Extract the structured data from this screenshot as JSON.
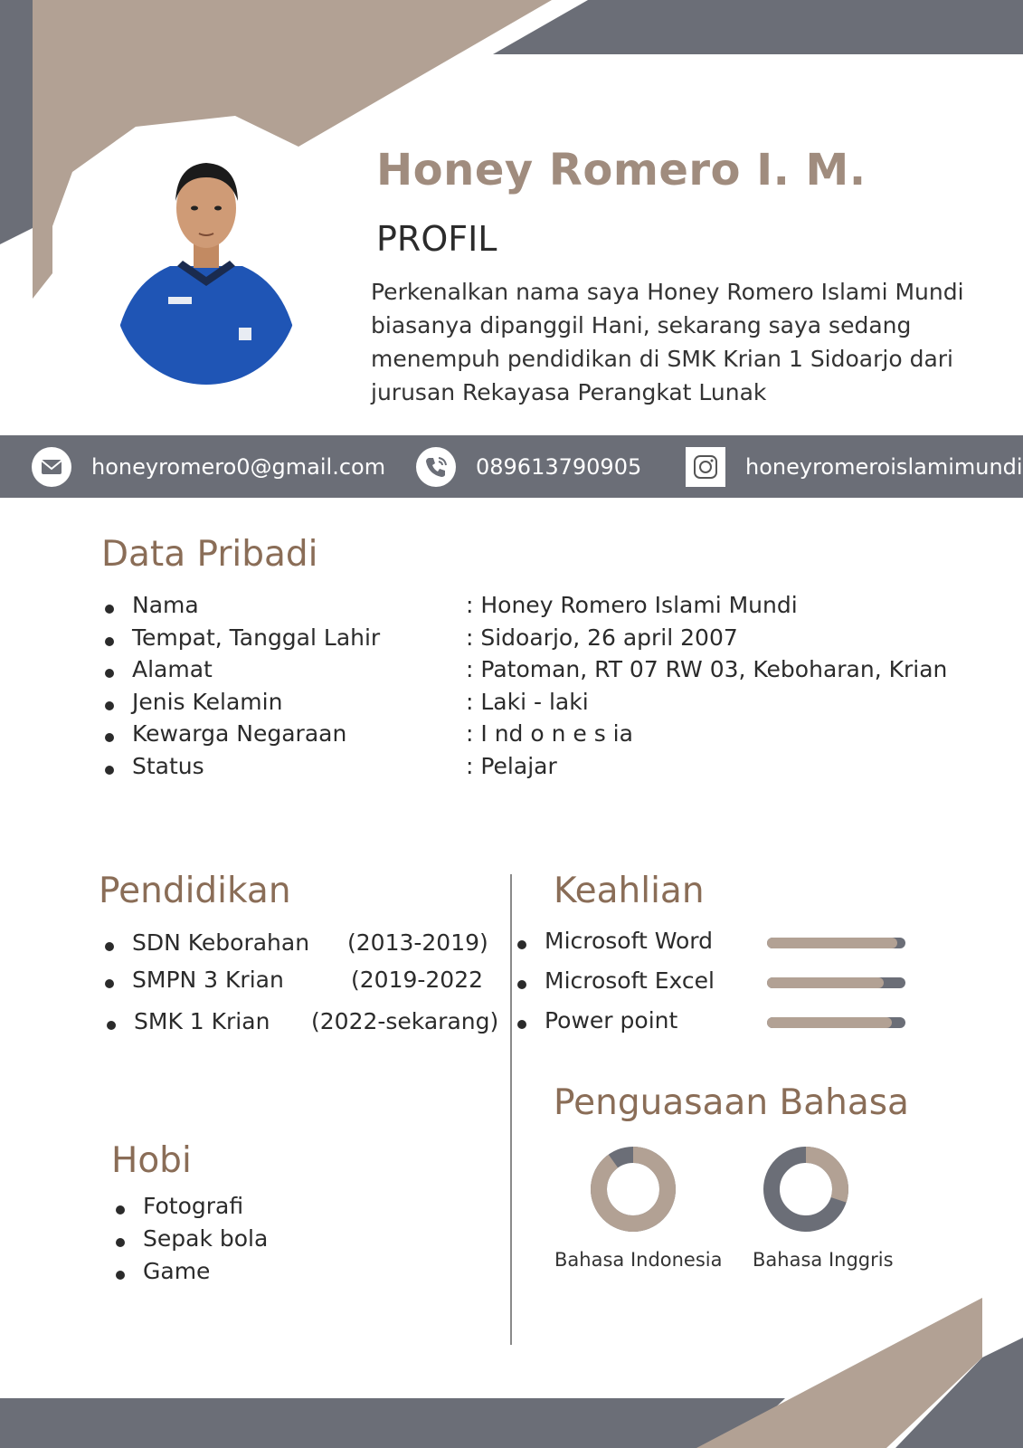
{
  "header": {
    "name": "Honey Romero I. M.",
    "profil_title": "PROFIL",
    "profil_lines": [
      "Perkenalkan nama saya Honey Romero Islami Mundi",
      "biasanya dipanggil Hani, sekarang saya sedang",
      "menempuh pendidikan di SMK Krian 1 Sidoarjo dari",
      "jurusan Rekayasa Perangkat Lunak"
    ]
  },
  "contact": {
    "email": "honeyromero0@gmail.com",
    "phone": "089613790905",
    "instagram": "honeyromeroislamimundi",
    "icons": [
      "mail-icon",
      "phone-icon",
      "instagram-icon"
    ]
  },
  "data_pribadi": {
    "title": "Data Pribadi",
    "rows": [
      {
        "label": "Nama",
        "value": ": Honey Romero Islami Mundi"
      },
      {
        "label": "Tempat, Tanggal Lahir",
        "value": ": Sidoarjo, 26 april 2007"
      },
      {
        "label": "Alamat",
        "value": ": Patoman, RT 07 RW 03, Keboharan, Krian"
      },
      {
        "label": "Jenis Kelamin",
        "value": ": Laki - laki"
      },
      {
        "label": "Kewarga Negaraan",
        "value": ": I nd o n e s ia"
      },
      {
        "label": "Status",
        "value": ": Pelajar"
      }
    ]
  },
  "pendidikan": {
    "title": "Pendidikan",
    "rows": [
      {
        "school": "SDN Keborahan",
        "years": "(2013-2019)"
      },
      {
        "school": "SMPN 3 Krian",
        "years": "(2019-2022"
      },
      {
        "school": "SMK 1 Krian",
        "years": "(2022-sekarang)"
      }
    ]
  },
  "keahlian": {
    "title": "Keahlian",
    "skills": [
      {
        "name": "Microsoft  Word",
        "level": 0.94
      },
      {
        "name": "Microsoft Excel",
        "level": 0.84
      },
      {
        "name": "Power point",
        "level": 0.9
      }
    ]
  },
  "hobi": {
    "title": "Hobi",
    "items": [
      "Fotografi",
      "Sepak bola",
      "Game"
    ]
  },
  "bahasa": {
    "title": "Penguasaan Bahasa",
    "languages": [
      {
        "name": "Bahasa Indonesia",
        "level": 0.9
      },
      {
        "name": "Bahasa Inggris",
        "level": 0.3
      }
    ]
  },
  "colors": {
    "beige": "#b2a194",
    "slate": "#6b6e77",
    "heading_brown": "#8a6d57",
    "name_color": "#a08c7e"
  }
}
